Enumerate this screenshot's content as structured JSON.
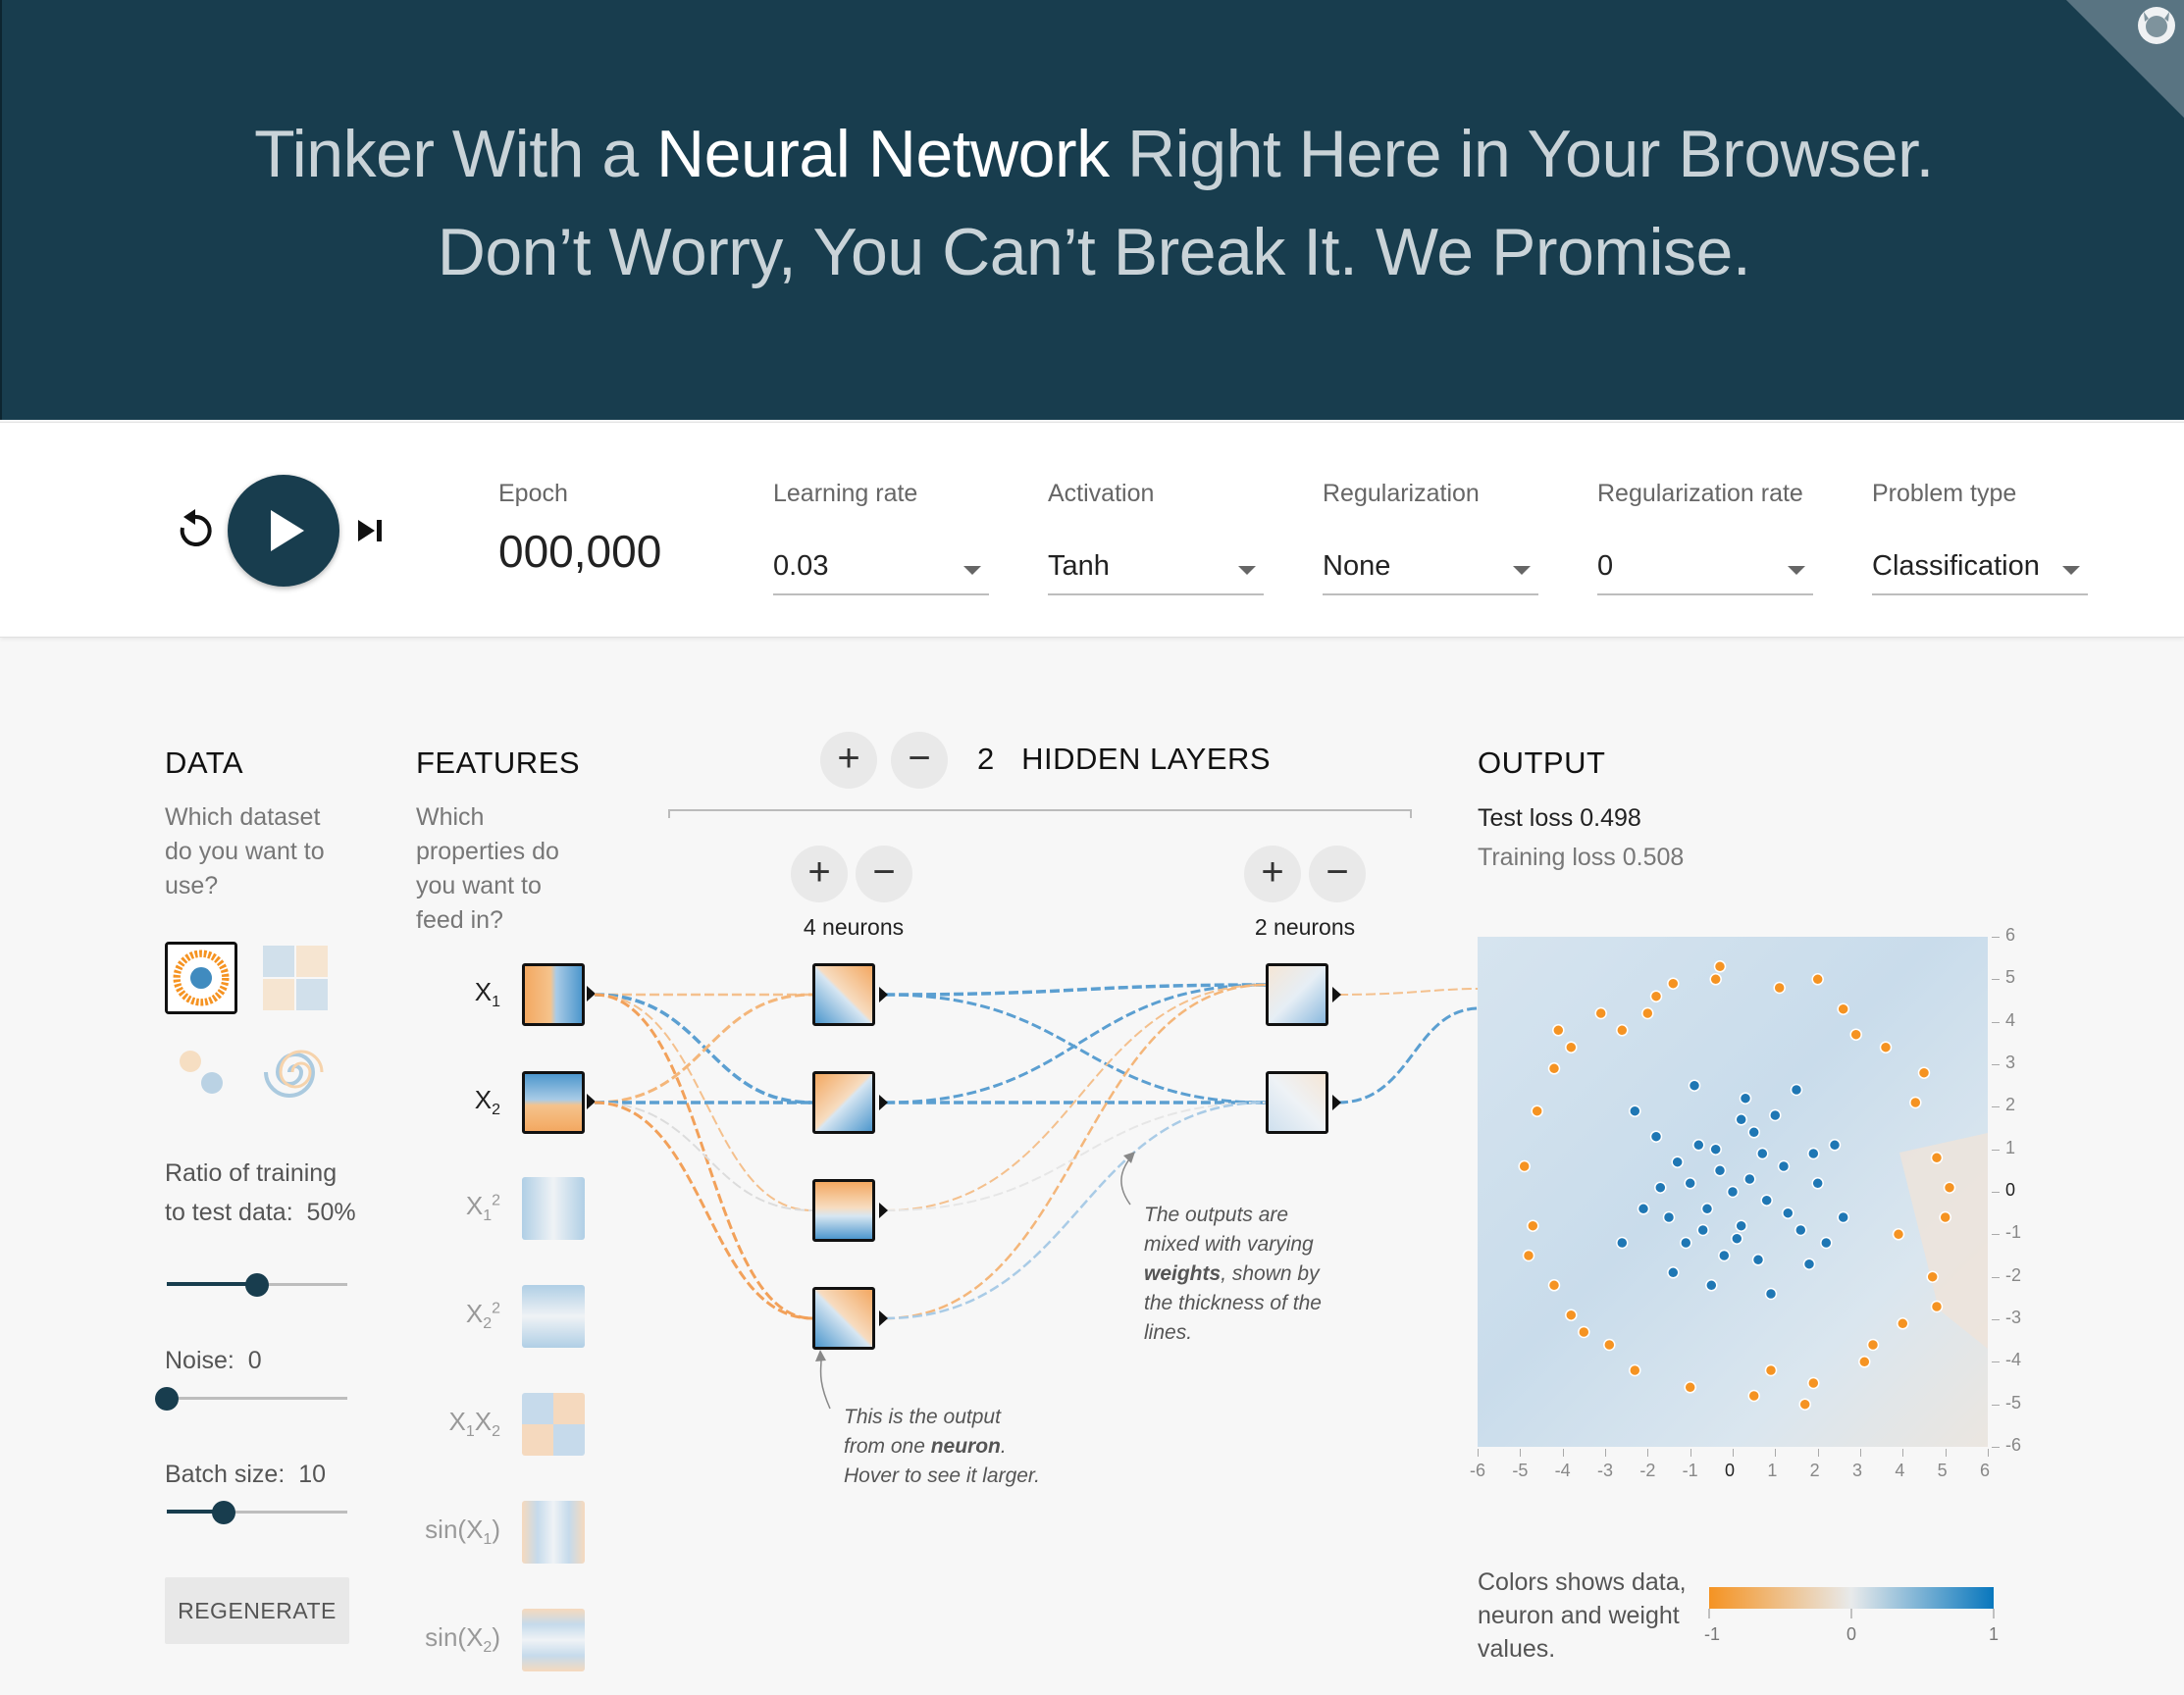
{
  "header": {
    "line1_pre": "Tinker With a ",
    "line1_bold": "Neural Network",
    "line1_post": " Right Here in Your Browser.",
    "line2": "Don’t Worry, You Can’t Break It. We Promise."
  },
  "toolbar": {
    "reset_icon": "reset-icon",
    "play_icon": "play-icon",
    "step_icon": "step-forward-icon",
    "epoch_label": "Epoch",
    "epoch_value": "000,000",
    "learning_rate": {
      "label": "Learning rate",
      "value": "0.03"
    },
    "activation": {
      "label": "Activation",
      "value": "Tanh"
    },
    "regularization": {
      "label": "Regularization",
      "value": "None"
    },
    "regularization_rate": {
      "label": "Regularization rate",
      "value": "0"
    },
    "problem_type": {
      "label": "Problem type",
      "value": "Classification"
    }
  },
  "data_panel": {
    "title": "DATA",
    "question": "Which dataset do you want to use?",
    "datasets": [
      "circle",
      "xor",
      "gaussian",
      "spiral"
    ],
    "selected_dataset": "circle",
    "ratio_label": "Ratio of training to test data:",
    "ratio_value": "50%",
    "ratio_fraction": 0.5,
    "noise_label": "Noise:",
    "noise_value": "0",
    "noise_fraction": 0,
    "batch_label": "Batch size:",
    "batch_value": "10",
    "batch_fraction": 0.33,
    "regenerate_label": "REGENERATE"
  },
  "features_panel": {
    "title": "FEATURES",
    "question": "Which properties do you want to feed in?",
    "features": [
      {
        "label": "X1",
        "active": true
      },
      {
        "label": "X2",
        "active": true
      },
      {
        "label": "X1²",
        "active": false
      },
      {
        "label": "X2²",
        "active": false
      },
      {
        "label": "X1X2",
        "active": false
      },
      {
        "label": "sin(X1)",
        "active": false
      },
      {
        "label": "sin(X2)",
        "active": false
      }
    ]
  },
  "network": {
    "hidden_layers_count": "2",
    "hidden_layers_label": "HIDDEN LAYERS",
    "layers": [
      {
        "neurons_label": "4 neurons"
      },
      {
        "neurons_label": "2 neurons"
      }
    ],
    "note_neuron": {
      "pre": "This is the output from one ",
      "bold": "neuron",
      "post": ". Hover to see it larger."
    },
    "note_weights": {
      "pre": "The outputs are mixed with varying ",
      "bold": "weights",
      "post": ", shown by the thickness of the lines."
    }
  },
  "output_panel": {
    "title": "OUTPUT",
    "test_loss_label": "Test loss",
    "test_loss_value": "0.498",
    "training_loss_label": "Training loss",
    "training_loss_value": "0.508",
    "legend_text": "Colors shows data, neuron and weight values.",
    "legend_ticks": [
      "-1",
      "0",
      "1"
    ]
  },
  "colors": {
    "header_bg": "#183d4e",
    "positive_blue": "#1f77b4",
    "negative_orange": "#f59322",
    "button_dark": "#183d4e"
  },
  "chart_data": {
    "type": "scatter",
    "title": "",
    "xlabel": "",
    "ylabel": "",
    "xlim": [
      -6,
      6
    ],
    "ylim": [
      -6,
      6
    ],
    "x_ticks": [
      "-6",
      "-5",
      "-4",
      "-3",
      "-2",
      "-1",
      "0",
      "1",
      "2",
      "3",
      "4",
      "5",
      "6"
    ],
    "y_ticks": [
      "6",
      "5",
      "4",
      "3",
      "2",
      "1",
      "0",
      "-1",
      "-2",
      "-3",
      "-4",
      "-5",
      "-6"
    ],
    "series": [
      {
        "color": "#1f77b4",
        "points": [
          [
            0,
            0
          ],
          [
            0.4,
            0.3
          ],
          [
            -0.3,
            0.5
          ],
          [
            0.8,
            -0.2
          ],
          [
            -0.6,
            -0.4
          ],
          [
            0.2,
            -0.8
          ],
          [
            -1,
            0.2
          ],
          [
            1.2,
            0.6
          ],
          [
            -0.8,
            1.1
          ],
          [
            0.5,
            1.4
          ],
          [
            -1.5,
            -0.6
          ],
          [
            1.6,
            -0.9
          ],
          [
            -0.2,
            -1.5
          ],
          [
            1,
            1.8
          ],
          [
            -1.8,
            1.3
          ],
          [
            2,
            0.2
          ],
          [
            -2.1,
            -0.4
          ],
          [
            0.3,
            2.2
          ],
          [
            -0.5,
            -2.2
          ],
          [
            1.8,
            -1.7
          ],
          [
            -1.4,
            -1.9
          ],
          [
            2.4,
            1.1
          ],
          [
            -2.3,
            1.9
          ],
          [
            0.9,
            -2.4
          ],
          [
            -2.6,
            -1.2
          ],
          [
            1.5,
            2.4
          ],
          [
            -0.9,
            2.5
          ],
          [
            2.6,
            -0.6
          ],
          [
            -1.1,
            -1.2
          ],
          [
            0.7,
            0.9
          ],
          [
            -0.4,
            1.0
          ],
          [
            1.3,
            -0.5
          ],
          [
            0.1,
            -1.1
          ],
          [
            -1.3,
            0.7
          ],
          [
            0.6,
            -1.6
          ],
          [
            -0.7,
            -0.9
          ],
          [
            1.9,
            0.9
          ],
          [
            -1.7,
            0.1
          ],
          [
            0.2,
            1.7
          ],
          [
            2.2,
            -1.2
          ]
        ]
      },
      {
        "color": "#f59322",
        "points": [
          [
            -3.8,
            3.4
          ],
          [
            -3.1,
            4.2
          ],
          [
            -1.8,
            4.6
          ],
          [
            -0.4,
            5.0
          ],
          [
            1.1,
            4.8
          ],
          [
            2.6,
            4.3
          ],
          [
            3.6,
            3.4
          ],
          [
            4.3,
            2.1
          ],
          [
            4.8,
            0.8
          ],
          [
            5,
            -0.6
          ],
          [
            4.7,
            -2.0
          ],
          [
            4.0,
            -3.1
          ],
          [
            3.1,
            -4.0
          ],
          [
            1.9,
            -4.5
          ],
          [
            0.5,
            -4.8
          ],
          [
            -1.0,
            -4.6
          ],
          [
            -2.3,
            -4.2
          ],
          [
            -3.5,
            -3.3
          ],
          [
            -4.2,
            -2.2
          ],
          [
            -4.7,
            -0.8
          ],
          [
            -4.9,
            0.6
          ],
          [
            -4.6,
            1.9
          ],
          [
            -4.2,
            2.9
          ],
          [
            -2.6,
            3.8
          ],
          [
            3.3,
            -3.6
          ],
          [
            4.5,
            2.8
          ],
          [
            -3.8,
            -2.9
          ],
          [
            0.9,
            -4.2
          ],
          [
            -0.3,
            5.3
          ],
          [
            2.0,
            5.0
          ],
          [
            -4.8,
            -1.5
          ],
          [
            5.1,
            0.1
          ],
          [
            -2.0,
            4.2
          ],
          [
            3.9,
            -1.0
          ],
          [
            -4.1,
            3.8
          ],
          [
            1.7,
            -5.0
          ],
          [
            -2.9,
            -3.6
          ],
          [
            4.8,
            -2.7
          ],
          [
            -1.4,
            4.9
          ],
          [
            2.9,
            3.7
          ]
        ]
      }
    ]
  }
}
